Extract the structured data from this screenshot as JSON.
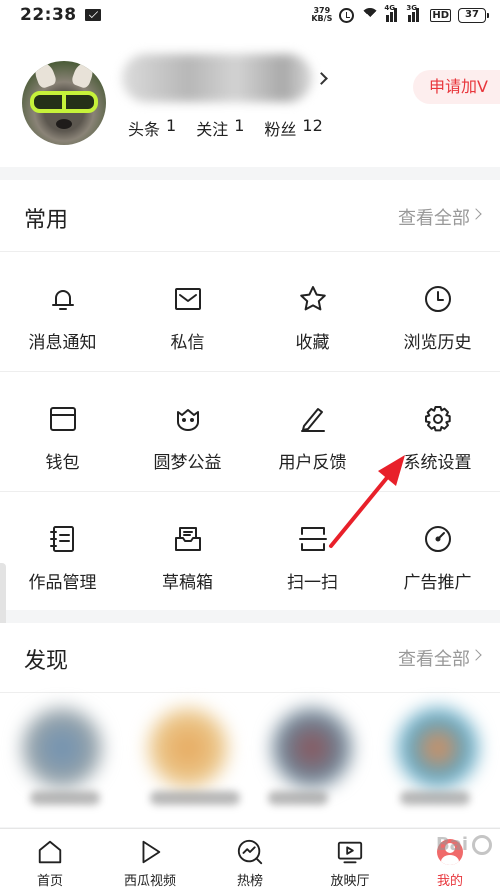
{
  "status_bar": {
    "time": "22:38",
    "net_speed_value": "379",
    "net_speed_unit": "KB/S",
    "sim1_tag": "4G",
    "sim2_tag": "3G",
    "hd_label": "HD",
    "battery": "37"
  },
  "profile": {
    "stats": [
      {
        "label": "头条",
        "value": "1"
      },
      {
        "label": "关注",
        "value": "1"
      },
      {
        "label": "粉丝",
        "value": "12"
      }
    ],
    "apply_v_label": "申请加V"
  },
  "common": {
    "title": "常用",
    "see_all": "查看全部",
    "rows": [
      [
        {
          "label": "消息通知",
          "icon": "bell-icon"
        },
        {
          "label": "私信",
          "icon": "mail-icon"
        },
        {
          "label": "收藏",
          "icon": "star-icon"
        },
        {
          "label": "浏览历史",
          "icon": "clock-icon"
        }
      ],
      [
        {
          "label": "钱包",
          "icon": "wallet-icon"
        },
        {
          "label": "圆梦公益",
          "icon": "charity-icon"
        },
        {
          "label": "用户反馈",
          "icon": "pencil-icon"
        },
        {
          "label": "系统设置",
          "icon": "gear-icon"
        }
      ],
      [
        {
          "label": "作品管理",
          "icon": "notebook-icon"
        },
        {
          "label": "草稿箱",
          "icon": "draft-box-icon"
        },
        {
          "label": "扫一扫",
          "icon": "scan-icon"
        },
        {
          "label": "广告推广",
          "icon": "gauge-icon"
        }
      ]
    ]
  },
  "discover": {
    "title": "发现",
    "see_all": "查看全部"
  },
  "bottom_nav": [
    {
      "label": "首页",
      "icon": "home-icon"
    },
    {
      "label": "西瓜视频",
      "icon": "play-icon"
    },
    {
      "label": "热榜",
      "icon": "hot-list-icon"
    },
    {
      "label": "放映厅",
      "icon": "tv-icon"
    },
    {
      "label": "我的",
      "icon": "profile-avatar-icon"
    }
  ],
  "watermark": "Bai",
  "colors": {
    "accent": "#e8363c",
    "annotation_arrow": "#e8202a"
  }
}
